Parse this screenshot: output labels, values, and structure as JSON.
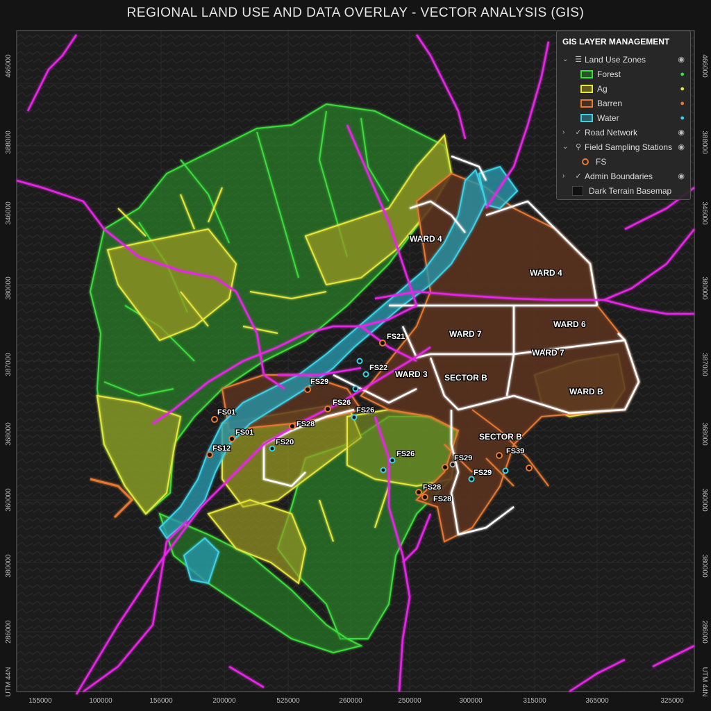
{
  "title": "REGIONAL LAND USE AND DATA OVERLAY - VECTOR ANALYSIS (GIS)",
  "panel": {
    "title": "GIS LAYER MANAGEMENT",
    "land_use": "Land Use Zones",
    "forest": "Forest",
    "ag": "Ag",
    "barren": "Barren",
    "water": "Water",
    "roads": "Road Network",
    "stations": "Field Sampling Stations",
    "fs": "FS",
    "admin": "Admin Boundaries",
    "basemap": "Dark Terrain Basemap"
  },
  "colors": {
    "forest": "#3cdc3c",
    "ag": "#e6e63c",
    "barren": "#e67830",
    "water": "#3cd2e6",
    "road": "#e628e6",
    "admin": "#ffffff"
  },
  "x_ticks": [
    "155000",
    "100000",
    "156000",
    "200000",
    "525000",
    "260000",
    "250000",
    "300000",
    "315000",
    "365000",
    "325000"
  ],
  "y_ticks_left": [
    "466000",
    "388000",
    "346000",
    "380000",
    "387000",
    "368000",
    "360000",
    "380000",
    "286000",
    "UTM 44N"
  ],
  "y_ticks_right": [
    "466000",
    "388000",
    "346000",
    "380000",
    "387000",
    "368000",
    "360000",
    "380000",
    "286000",
    "UTM 44N"
  ],
  "zone_labels": {
    "ward4a": "WARD 4",
    "ward4b": "WARD 4",
    "ward7a": "WARD 7",
    "ward6": "WARD 6",
    "ward7b": "WARD 7",
    "ward3": "WARD 3",
    "sectorb1": "SECTOR B",
    "wardb": "WARD B",
    "sectorb2": "SECTOR B"
  },
  "stations": {
    "s1": "FS21",
    "s2": "FS22",
    "s3": "FS29",
    "s4": "FS26",
    "s5": "FS26",
    "s6": "FS01",
    "s7": "FS01",
    "s8": "FS28",
    "s9": "FS12",
    "s10": "FS20",
    "s11": "FS26",
    "s12": "FS29",
    "s13": "FS39",
    "s14": "FS29",
    "s15": "FS28",
    "s16": "FS28"
  }
}
